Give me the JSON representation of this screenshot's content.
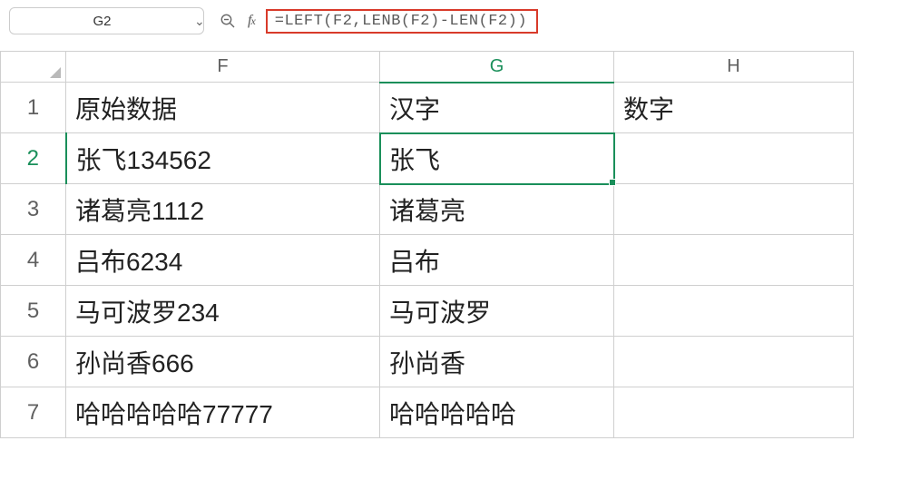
{
  "name_box": {
    "value": "G2"
  },
  "formula_bar": {
    "value": "=LEFT(F2,LENB(F2)-LEN(F2))"
  },
  "columns": [
    "F",
    "G",
    "H"
  ],
  "selected_col_index": 1,
  "selected_row_index": 1,
  "rows": [
    {
      "num": "1",
      "F": "原始数据",
      "G": "汉字",
      "H": "数字"
    },
    {
      "num": "2",
      "F": "张飞134562",
      "G": "张飞",
      "H": ""
    },
    {
      "num": "3",
      "F": "诸葛亮1112",
      "G": "诸葛亮",
      "H": ""
    },
    {
      "num": "4",
      "F": "吕布6234",
      "G": "吕布",
      "H": ""
    },
    {
      "num": "5",
      "F": "马可波罗234",
      "G": "马可波罗",
      "H": ""
    },
    {
      "num": "6",
      "F": "孙尚香666",
      "G": "孙尚香",
      "H": ""
    },
    {
      "num": "7",
      "F": "哈哈哈哈哈77777",
      "G": "哈哈哈哈哈",
      "H": ""
    }
  ],
  "selected_cell": "G2",
  "chart_data": {
    "type": "table",
    "title": "",
    "columns": [
      "原始数据",
      "汉字",
      "数字"
    ],
    "rows": [
      [
        "张飞134562",
        "张飞",
        ""
      ],
      [
        "诸葛亮1112",
        "诸葛亮",
        ""
      ],
      [
        "吕布6234",
        "吕布",
        ""
      ],
      [
        "马可波罗234",
        "马可波罗",
        ""
      ],
      [
        "孙尚香666",
        "孙尚香",
        ""
      ],
      [
        "哈哈哈哈哈77777",
        "哈哈哈哈哈",
        ""
      ]
    ]
  }
}
